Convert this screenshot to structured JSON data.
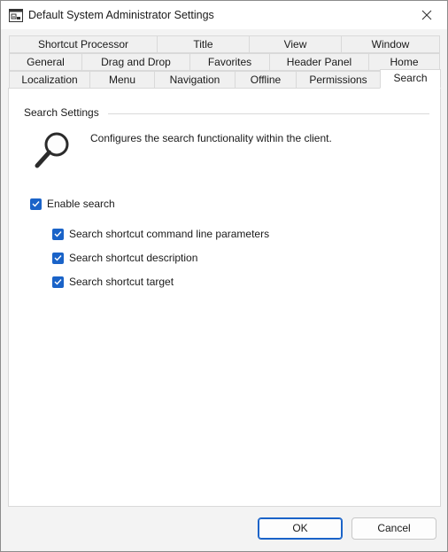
{
  "window": {
    "title": "Default System Administrator Settings"
  },
  "tabs": {
    "row1": [
      "Shortcut Processor",
      "Title",
      "View",
      "Window"
    ],
    "row2": [
      "General",
      "Drag and Drop",
      "Favorites",
      "Header Panel",
      "Home"
    ],
    "row3": [
      "Localization",
      "Menu",
      "Navigation",
      "Offline",
      "Permissions",
      "Search"
    ],
    "active": "Search"
  },
  "panel": {
    "group_label": "Search Settings",
    "description": "Configures the search functionality within the client.",
    "graphic_icon": "magnifier-icon",
    "enable_search": {
      "label": "Enable search",
      "checked": true
    },
    "options": [
      {
        "label": "Search shortcut command line parameters",
        "checked": true
      },
      {
        "label": "Search shortcut description",
        "checked": true
      },
      {
        "label": "Search shortcut target",
        "checked": true
      }
    ]
  },
  "buttons": {
    "ok": "OK",
    "cancel": "Cancel"
  },
  "colors": {
    "accent": "#1a63c8",
    "tab_inactive": "#f0f0f0",
    "panel_bg": "#ffffff",
    "window_bg": "#f3f3f3"
  }
}
